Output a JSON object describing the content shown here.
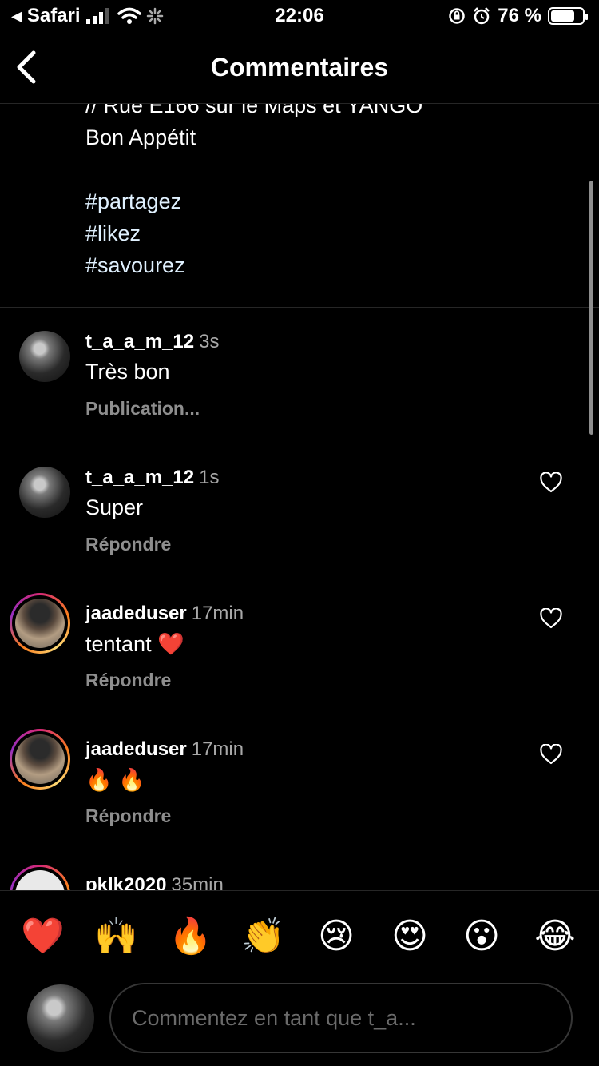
{
  "status_bar": {
    "back_app": "Safari",
    "time": "22:06",
    "battery_percent": "76 %",
    "battery_level": 0.76
  },
  "nav": {
    "title": "Commentaires"
  },
  "caption": {
    "lines": [
      {
        "text": "// Rue E166 sur le Maps et YANGO",
        "type": "text"
      },
      {
        "text": "Bon Appétit",
        "type": "text"
      },
      {
        "text": "",
        "type": "blank"
      },
      {
        "text": "#partagez",
        "type": "hashtag"
      },
      {
        "text": "#likez",
        "type": "hashtag"
      },
      {
        "text": "#savourez",
        "type": "hashtag"
      }
    ]
  },
  "comments": [
    {
      "username": "t_a_a_m_12",
      "time": "3s",
      "text": "Très bon",
      "action": "Publication...",
      "has_heart": false,
      "avatar": "bw-photo",
      "story_ring": false
    },
    {
      "username": "t_a_a_m_12",
      "time": "1s",
      "text": "Super",
      "action": "Répondre",
      "has_heart": true,
      "avatar": "bw-photo",
      "story_ring": false
    },
    {
      "username": "jaadeduser",
      "time": "17min",
      "text": "tentant ❤️",
      "action": "Répondre",
      "has_heart": true,
      "avatar": "graduation-photo",
      "story_ring": true
    },
    {
      "username": "jaadeduser",
      "time": "17min",
      "text": "🔥 🔥",
      "action": "Répondre",
      "has_heart": true,
      "avatar": "graduation-photo",
      "story_ring": true
    },
    {
      "username": "pklk2020",
      "time": "35min",
      "text": "",
      "action": "",
      "has_heart": false,
      "avatar": "light-photo",
      "story_ring": true
    }
  ],
  "reactions": [
    "❤️",
    "🙌",
    "🔥",
    "👏",
    "😢",
    "😍",
    "😮",
    "😂"
  ],
  "composer": {
    "placeholder": "Commentez en tant que t_a..."
  }
}
